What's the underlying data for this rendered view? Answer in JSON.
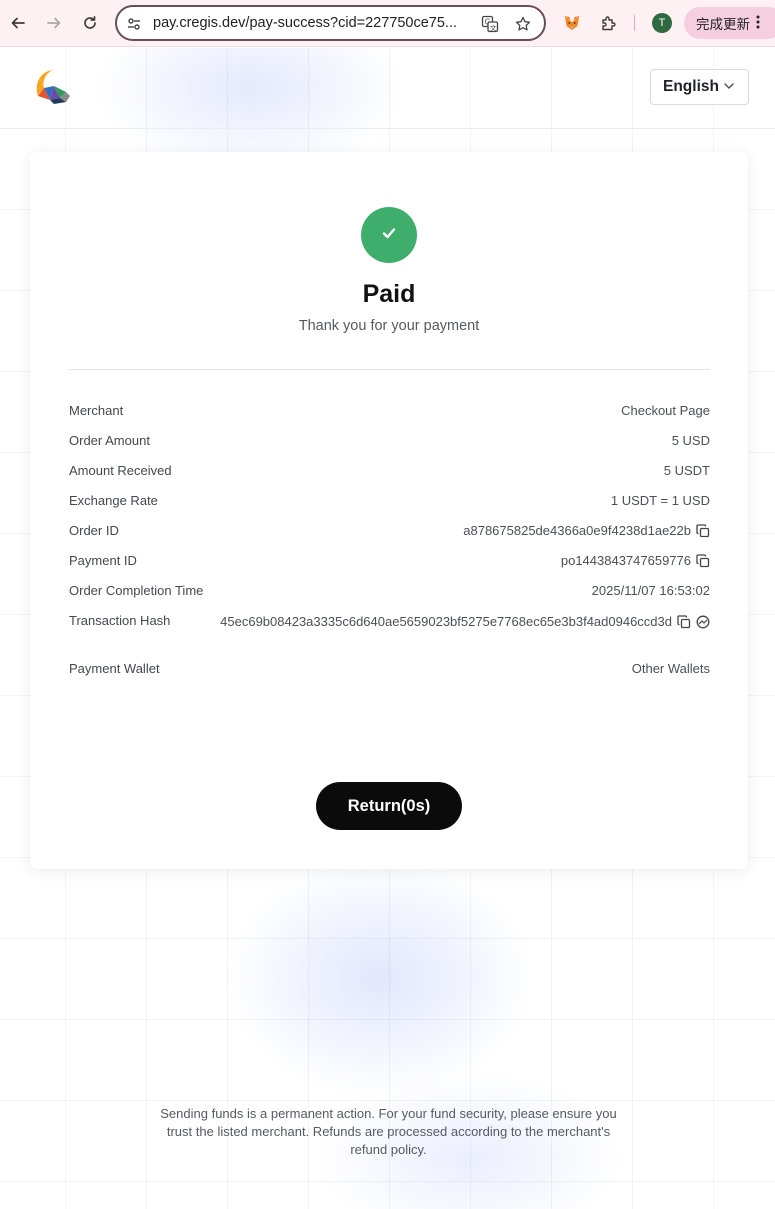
{
  "browser": {
    "url": "pay.cregis.dev/pay-success?cid=227750ce75...",
    "avatar_letter": "T",
    "update_button_label": "完成更新"
  },
  "header": {
    "language_label": "English"
  },
  "payment": {
    "status_title": "Paid",
    "status_subtitle": "Thank you for your payment",
    "details": [
      {
        "label": "Merchant",
        "value": "Checkout Page"
      },
      {
        "label": "Order Amount",
        "value": "5 USD"
      },
      {
        "label": "Amount Received",
        "value": "5 USDT"
      },
      {
        "label": "Exchange Rate",
        "value": "1 USDT = 1 USD"
      },
      {
        "label": "Order ID",
        "value": "a878675825de4366a0e9f4238d1ae22b"
      },
      {
        "label": "Payment ID",
        "value": "po1443843747659776"
      },
      {
        "label": "Order Completion Time",
        "value": "2025/11/07 16:53:02"
      },
      {
        "label": "Transaction Hash",
        "value": "45ec69b08423a3335c6d640ae5659023bf5275e7768ec65e3b3f4ad0946ccd3d"
      },
      {
        "label": "Payment Wallet",
        "value": "Other Wallets"
      }
    ],
    "return_button_label": "Return(0s)"
  },
  "footer": {
    "disclaimer": "Sending funds is a permanent action. For your fund security, please ensure you trust the listed merchant. Refunds are processed according to the merchant's refund policy."
  },
  "colors": {
    "success": "#3fae6c",
    "primary_button": "#0b0b0b",
    "omnibox_border": "#6b4c5a",
    "update_button": "#f5cfe0"
  },
  "icons": [
    "back-arrow-icon",
    "forward-arrow-icon",
    "reload-icon",
    "site-info-icon",
    "translate-icon",
    "bookmark-star-icon",
    "metamask-icon",
    "extensions-icon",
    "more-icon",
    "chevron-down-icon",
    "checkmark-icon",
    "copy-icon",
    "explorer-icon"
  ]
}
